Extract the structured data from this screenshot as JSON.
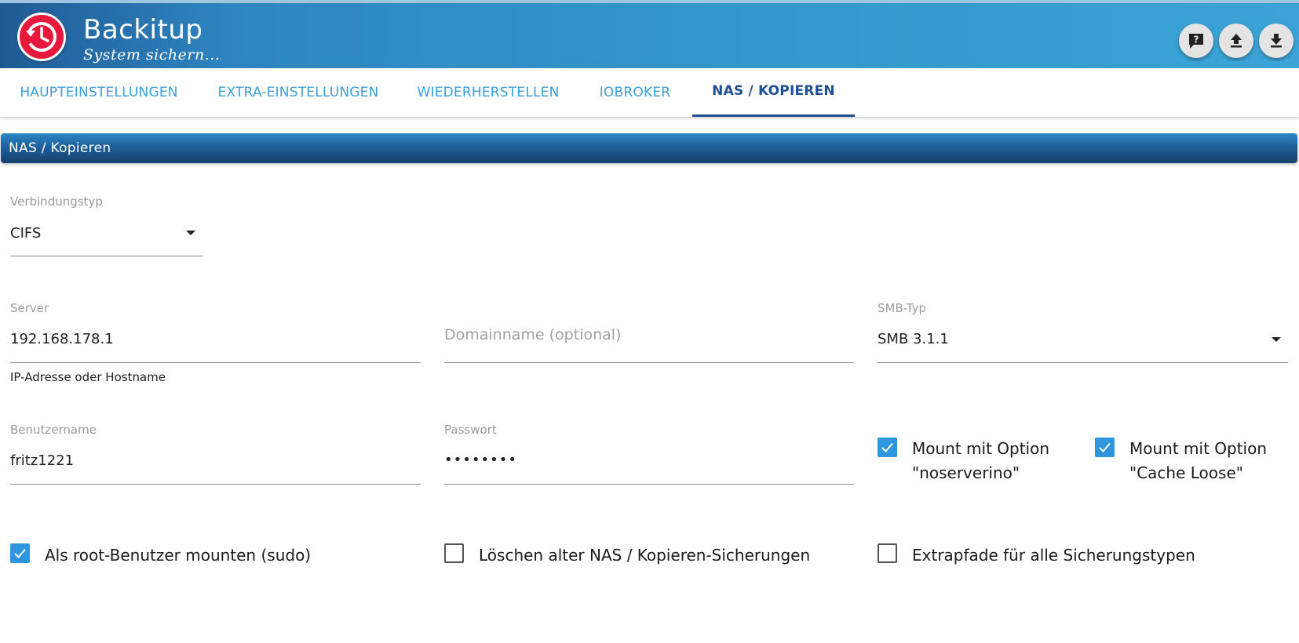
{
  "header": {
    "title": "Backitup",
    "subtitle": "System sichern...",
    "logo_icon": "clock-history-icon",
    "buttons": [
      {
        "name": "help-button",
        "icon": "help-icon"
      },
      {
        "name": "upload-button",
        "icon": "upload-icon"
      },
      {
        "name": "download-button",
        "icon": "download-icon"
      }
    ]
  },
  "tabs": [
    {
      "label": "Haupteinstellungen",
      "active": false
    },
    {
      "label": "Extra-Einstellungen",
      "active": false
    },
    {
      "label": "Wiederherstellen",
      "active": false
    },
    {
      "label": "ioBroker",
      "active": false
    },
    {
      "label": "NAS / Kopieren",
      "active": true
    }
  ],
  "section": {
    "title": "NAS / Kopieren"
  },
  "form": {
    "connection_type": {
      "label": "Verbindungstyp",
      "value": "CIFS"
    },
    "server": {
      "label": "Server",
      "value": "192.168.178.1",
      "helper": "IP-Adresse oder Hostname"
    },
    "domain": {
      "placeholder": "Domainname (optional)"
    },
    "smb_type": {
      "label": "SMB-Typ",
      "value": "SMB 3.1.1"
    },
    "username": {
      "label": "Benutzername",
      "value": "fritz1221"
    },
    "password": {
      "label": "Passwort",
      "value": "••••••••"
    },
    "mount_noserverino": {
      "label_line1": "Mount mit Option",
      "label_line2": "\"noserverino\"",
      "checked": true
    },
    "mount_cache_loose": {
      "label_line1": "Mount mit Option",
      "label_line2": "\"Cache Loose\"",
      "checked": true
    },
    "sudo_mount": {
      "label": "Als root-Benutzer mounten (sudo)",
      "checked": true
    },
    "delete_old": {
      "label": "Löschen alter NAS / Kopieren-Sicherungen",
      "checked": false
    },
    "extra_paths": {
      "label": "Extrapfade für alle Sicherungstypen",
      "checked": false
    }
  },
  "colors": {
    "header_gradient_start": "#1f5a94",
    "header_gradient_end": "#3ba3d6",
    "tab_text": "#3a9ed8",
    "tab_active": "#1f4f93",
    "logo_red": "#e8173c",
    "checkbox_blue": "#2f95dc"
  }
}
